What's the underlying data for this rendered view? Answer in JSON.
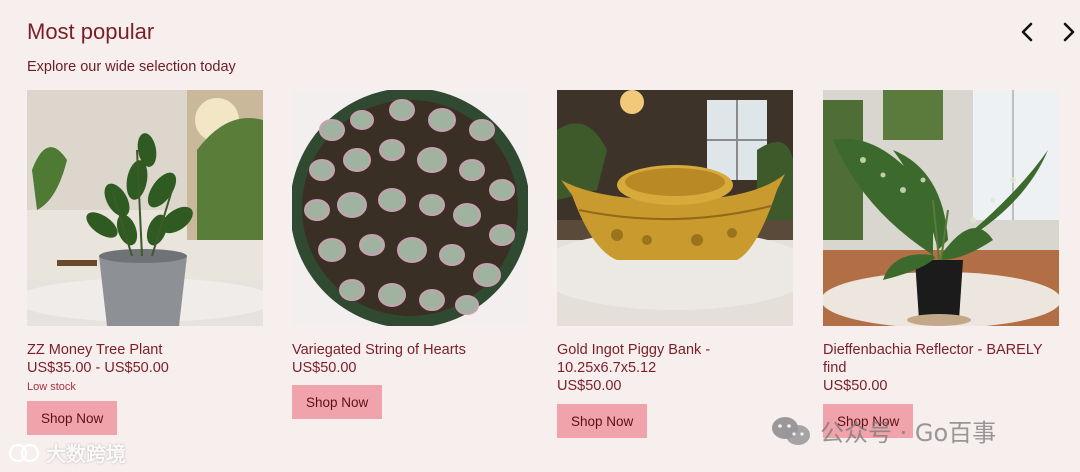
{
  "section": {
    "title": "Most popular",
    "subtitle": "Explore our wide selection today"
  },
  "products": [
    {
      "name": "ZZ Money Tree Plant",
      "price": "US$35.00 - US$50.00",
      "stock": "Low stock",
      "button": "Shop Now",
      "image": "zz-plant-image"
    },
    {
      "name": "Variegated String of Hearts",
      "price": "US$50.00",
      "stock": "",
      "button": "Shop Now",
      "image": "string-of-hearts-image"
    },
    {
      "name": "Gold Ingot Piggy Bank - 10.25x6.7x5.12",
      "price": "US$50.00",
      "stock": "",
      "button": "Shop Now",
      "image": "gold-ingot-image"
    },
    {
      "name": "Dieffenbachia Reflector - BARELY find",
      "price": "US$50.00",
      "stock": "",
      "button": "Shop Now",
      "image": "dieffenbachia-image"
    }
  ],
  "watermarks": {
    "left": "大数跨境",
    "right": "公众号 · Go百事"
  },
  "colors": {
    "background": "#f7eeee",
    "text": "#7a1f28",
    "button": "#f0a3ab",
    "stock": "#a8323c"
  }
}
